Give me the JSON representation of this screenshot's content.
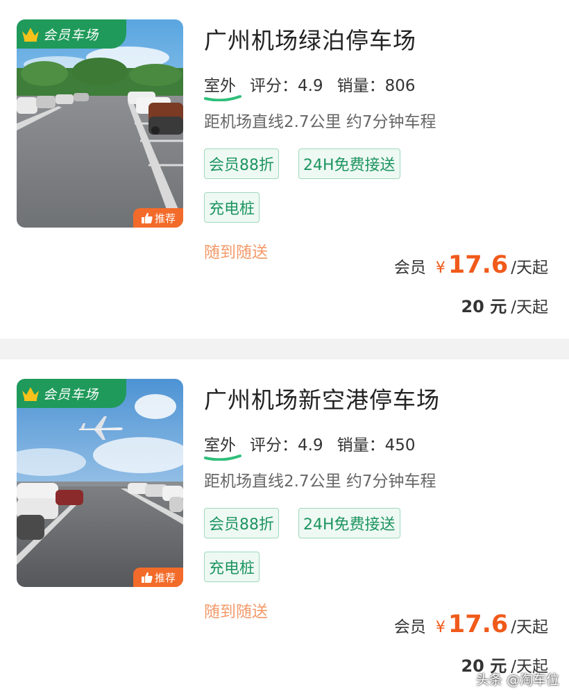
{
  "colors": {
    "accent_green": "#1d9460",
    "badge_green": "#1f9a5a",
    "price_orange": "#f05a1a",
    "service_orange": "#f39a6a",
    "recommend_orange": "#f36b2a"
  },
  "listings": [
    {
      "badge": "会员车场",
      "recommend": "推荐",
      "title": "广州机场绿泊停车场",
      "location_type": "室外",
      "rating_label": "评分：",
      "rating": "4.9",
      "sales_label": "销量：",
      "sales": "806",
      "distance": "距机场直线2.7公里 约7分钟车程",
      "tags": [
        "会员88折",
        "24H免费接送",
        "充电桩"
      ],
      "service": "随到随送",
      "member_label": "会员",
      "currency": "¥",
      "member_price": "17.6",
      "price_unit": "/天起",
      "original_price": "20 元",
      "original_unit": "/天起",
      "image_icon": "parking-lot-photo"
    },
    {
      "badge": "会员车场",
      "recommend": "推荐",
      "title": "广州机场新空港停车场",
      "location_type": "室外",
      "rating_label": "评分：",
      "rating": "4.9",
      "sales_label": "销量：",
      "sales": "450",
      "distance": "距机场直线2.7公里 约7分钟车程",
      "tags": [
        "会员88折",
        "24H免费接送",
        "充电桩"
      ],
      "service": "随到随送",
      "member_label": "会员",
      "currency": "¥",
      "member_price": "17.6",
      "price_unit": "/天起",
      "original_price": "20 元",
      "original_unit": "/天起",
      "image_icon": "parking-lot-airplane-photo"
    }
  ],
  "watermark": "头条 @淘车位"
}
